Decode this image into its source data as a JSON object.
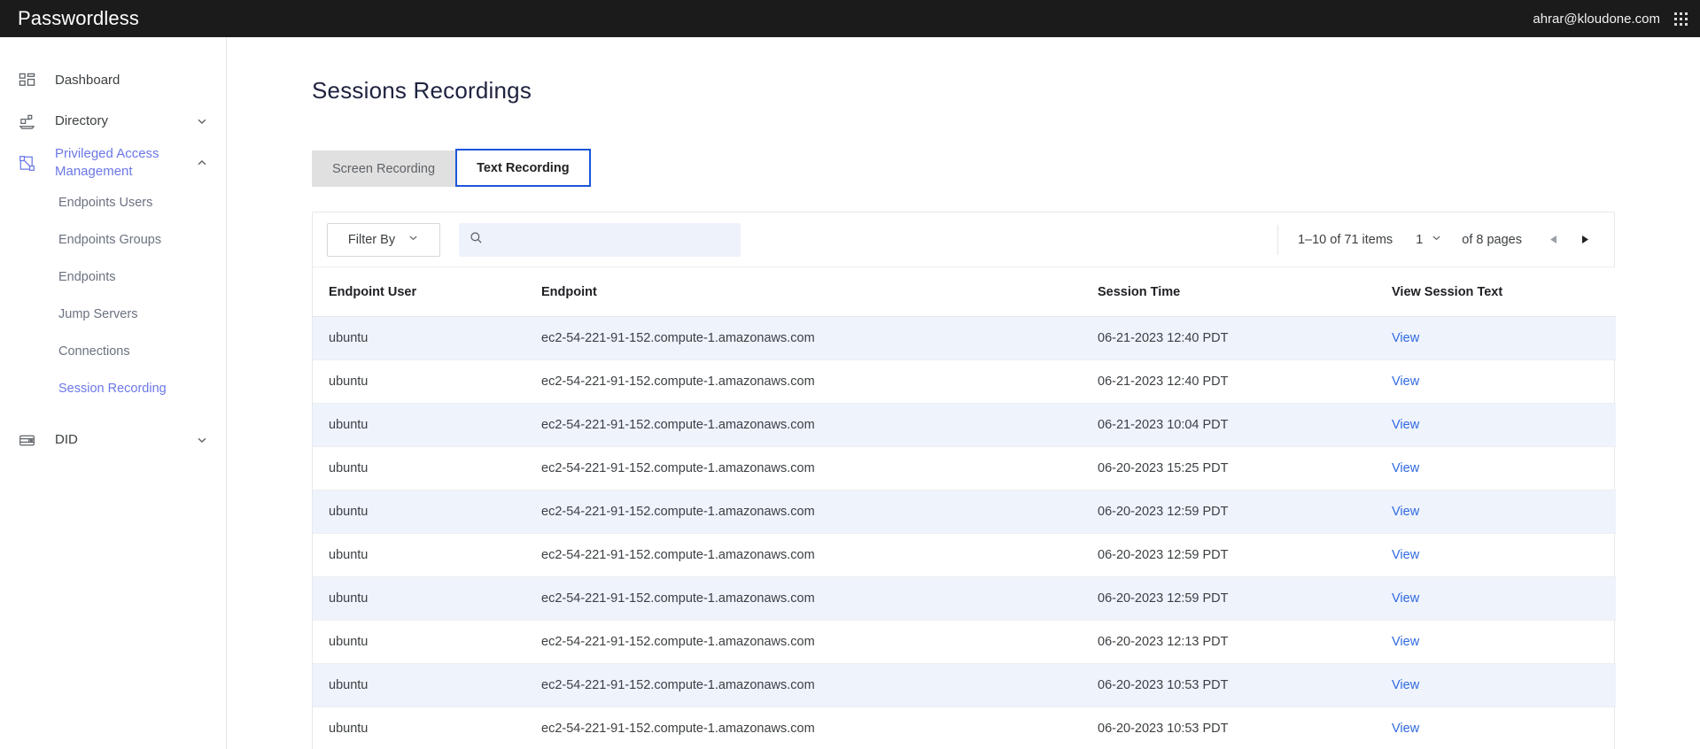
{
  "topbar": {
    "brand": "Passwordless",
    "user_email": "ahrar@kloudone.com",
    "apps_icon": "grid-3x3-icon"
  },
  "sidebar": {
    "items": [
      {
        "label": "Dashboard",
        "icon": "dashboard-grid-icon",
        "active": false,
        "expandable": false
      },
      {
        "label": "Directory",
        "icon": "directory-org-icon",
        "active": false,
        "expandable": true,
        "chevron": "chevron-down-icon"
      },
      {
        "label": "Privileged Access Management",
        "icon": "pam-nodes-icon",
        "active": true,
        "expandable": true,
        "chevron": "chevron-up-icon"
      },
      {
        "label": "DID",
        "icon": "wallet-icon",
        "active": false,
        "expandable": true,
        "chevron": "chevron-down-icon"
      }
    ],
    "pam_children": [
      {
        "label": "Endpoints Users",
        "active": false
      },
      {
        "label": "Endpoints Groups",
        "active": false
      },
      {
        "label": "Endpoints",
        "active": false
      },
      {
        "label": "Jump Servers",
        "active": false
      },
      {
        "label": "Connections",
        "active": false
      },
      {
        "label": "Session Recording",
        "active": true
      }
    ]
  },
  "main": {
    "page_title": "Sessions Recordings",
    "tabs": [
      {
        "label": "Screen Recording",
        "active": false
      },
      {
        "label": "Text Recording",
        "active": true
      }
    ],
    "toolbar": {
      "filter_label": "Filter By",
      "filter_chevron": "chevron-down-icon",
      "search_icon": "search-icon",
      "search_value": "",
      "search_placeholder": ""
    },
    "pagination": {
      "items_range": "1–10 of 71 items",
      "current_page": "1",
      "page_chevron": "chevron-down-icon",
      "total_pages_label": "of 8 pages",
      "prev_icon": "triangle-left-icon",
      "next_icon": "triangle-right-icon"
    },
    "table": {
      "columns": [
        "Endpoint User",
        "Endpoint",
        "Session Time",
        "View Session Text"
      ],
      "rows": [
        {
          "user": "ubuntu",
          "endpoint": "ec2-54-221-91-152.compute-1.amazonaws.com",
          "time": "06-21-2023 12:40 PDT",
          "action": "View"
        },
        {
          "user": "ubuntu",
          "endpoint": "ec2-54-221-91-152.compute-1.amazonaws.com",
          "time": "06-21-2023 12:40 PDT",
          "action": "View"
        },
        {
          "user": "ubuntu",
          "endpoint": "ec2-54-221-91-152.compute-1.amazonaws.com",
          "time": "06-21-2023 10:04 PDT",
          "action": "View"
        },
        {
          "user": "ubuntu",
          "endpoint": "ec2-54-221-91-152.compute-1.amazonaws.com",
          "time": "06-20-2023 15:25 PDT",
          "action": "View"
        },
        {
          "user": "ubuntu",
          "endpoint": "ec2-54-221-91-152.compute-1.amazonaws.com",
          "time": "06-20-2023 12:59 PDT",
          "action": "View"
        },
        {
          "user": "ubuntu",
          "endpoint": "ec2-54-221-91-152.compute-1.amazonaws.com",
          "time": "06-20-2023 12:59 PDT",
          "action": "View"
        },
        {
          "user": "ubuntu",
          "endpoint": "ec2-54-221-91-152.compute-1.amazonaws.com",
          "time": "06-20-2023 12:59 PDT",
          "action": "View"
        },
        {
          "user": "ubuntu",
          "endpoint": "ec2-54-221-91-152.compute-1.amazonaws.com",
          "time": "06-20-2023 12:13 PDT",
          "action": "View"
        },
        {
          "user": "ubuntu",
          "endpoint": "ec2-54-221-91-152.compute-1.amazonaws.com",
          "time": "06-20-2023 10:53 PDT",
          "action": "View"
        },
        {
          "user": "ubuntu",
          "endpoint": "ec2-54-221-91-152.compute-1.amazonaws.com",
          "time": "06-20-2023 10:53 PDT",
          "action": "View"
        }
      ]
    }
  },
  "colors": {
    "topbar_bg": "#1b1b1b",
    "accent_purple": "#6b77e8",
    "tab_active_border": "#1a56db",
    "link_blue": "#2f6ae0",
    "row_alt_bg": "#eff3fc",
    "search_bg": "#eef2fb"
  }
}
